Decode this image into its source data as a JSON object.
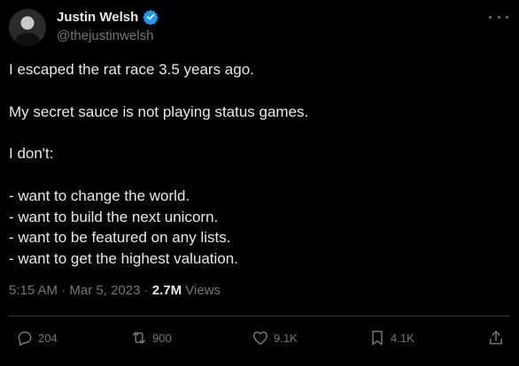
{
  "author": {
    "name": "Justin Welsh",
    "handle": "@thejustinwelsh",
    "verified": true
  },
  "tweet": {
    "lines": [
      "I escaped the rat race 3.5 years ago.",
      "",
      "My secret sauce is not playing status games.",
      "",
      "I don't:",
      "",
      "- want to change the world.",
      "- want to build the next unicorn.",
      "- want to be featured on any lists.",
      "- want to get the highest valuation."
    ]
  },
  "meta": {
    "time": "5:15 AM",
    "separator": " · ",
    "date": "Mar 5, 2023",
    "views_count": "2.7M",
    "views_label": " Views"
  },
  "actions": {
    "reply": {
      "icon": "reply-icon",
      "count": "204"
    },
    "repost": {
      "icon": "repost-icon",
      "count": "900"
    },
    "like": {
      "icon": "heart-icon",
      "count": "9.1K"
    },
    "bookmark": {
      "icon": "bookmark-icon",
      "count": "4.1K"
    },
    "share": {
      "icon": "share-icon"
    }
  },
  "colors": {
    "background": "#000000",
    "text": "#e7e9ea",
    "muted": "#71767b",
    "verified": "#1d9bf0",
    "divider": "#2f3336"
  }
}
